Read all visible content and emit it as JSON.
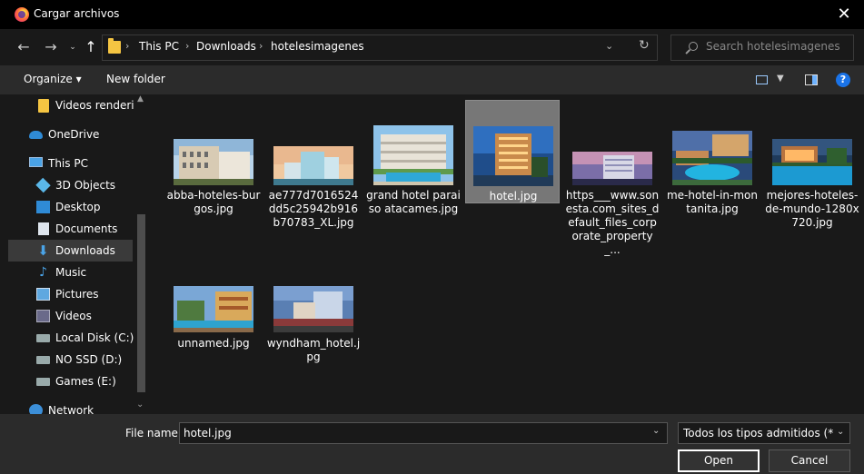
{
  "window": {
    "title": "Cargar archivos"
  },
  "breadcrumb": [
    "This PC",
    "Downloads",
    "hotelesimagenes"
  ],
  "search": {
    "placeholder": "Search hotelesimagenes"
  },
  "toolbar": {
    "organize_label": "Organize ▾",
    "new_folder_label": "New folder"
  },
  "sidebar": {
    "items": [
      {
        "label": "Videos renderiza",
        "icon": "folder-icon"
      },
      {
        "label": "OneDrive",
        "icon": "cloud-icon"
      },
      {
        "label": "This PC",
        "icon": "computer-icon"
      },
      {
        "label": "3D Objects",
        "icon": "cube-icon"
      },
      {
        "label": "Desktop",
        "icon": "desktop-icon"
      },
      {
        "label": "Documents",
        "icon": "documents-icon"
      },
      {
        "label": "Downloads",
        "icon": "download-icon",
        "selected": true
      },
      {
        "label": "Music",
        "icon": "music-icon"
      },
      {
        "label": "Pictures",
        "icon": "pictures-icon"
      },
      {
        "label": "Videos",
        "icon": "videos-icon"
      },
      {
        "label": "Local Disk (C:)",
        "icon": "disk-icon"
      },
      {
        "label": "NO SSD (D:)",
        "icon": "disk-icon"
      },
      {
        "label": "Games (E:)",
        "icon": "disk-icon"
      },
      {
        "label": "Network",
        "icon": "network-icon"
      }
    ]
  },
  "files": [
    {
      "name": "abba-hoteles-burgos.jpg"
    },
    {
      "name": "ae777d7016524dd5c25942b916b70783_XL.jpg"
    },
    {
      "name": "grand hotel paraiso atacames.jpg"
    },
    {
      "name": "hotel.jpg",
      "selected": true
    },
    {
      "name": "https___www.sonesta.com_sites_default_files_corporate_property_..."
    },
    {
      "name": "me-hotel-in-montanita.jpg"
    },
    {
      "name": "mejores-hoteles-de-mundo-1280x720.jpg"
    },
    {
      "name": "unnamed.jpg"
    },
    {
      "name": "wyndham_hotel.jpg"
    }
  ],
  "filename": {
    "label": "File name:",
    "value": "hotel.jpg"
  },
  "filetype": {
    "selected": "Todos los tipos admitidos (*.pn"
  },
  "buttons": {
    "open": "Open",
    "cancel": "Cancel"
  }
}
